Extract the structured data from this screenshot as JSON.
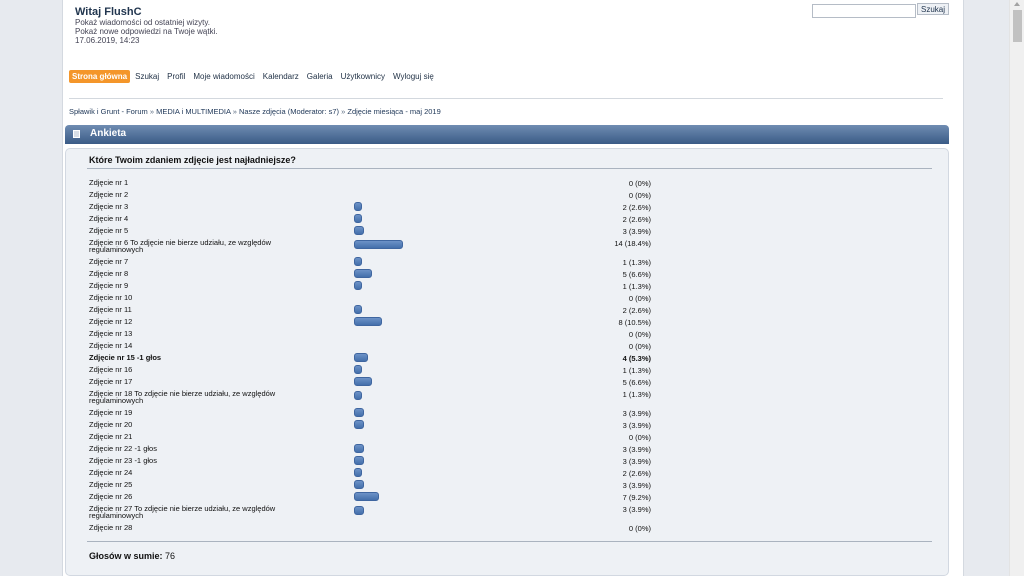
{
  "header": {
    "welcome": "Witaj FlushC",
    "line1": "Pokaż wiadomości od ostatniej wizyty.",
    "line2": "Pokaż nowe odpowiedzi na Twoje wątki.",
    "datetime": "17.06.2019, 14:23",
    "search_placeholder": "",
    "search_button": "Szukaj"
  },
  "nav": [
    {
      "label": "Strona główna",
      "active": true
    },
    {
      "label": "Szukaj"
    },
    {
      "label": "Profil"
    },
    {
      "label": "Moje wiadomości"
    },
    {
      "label": "Kalendarz"
    },
    {
      "label": "Galeria"
    },
    {
      "label": "Użytkownicy"
    },
    {
      "label": "Wyloguj się"
    }
  ],
  "breadcrumb": [
    "Spławik i Grunt - Forum",
    "MEDIA i MULTIMEDIA",
    "Nasze zdjęcia (Moderator: s7)",
    "Zdjęcie miesiąca - maj 2019"
  ],
  "breadcrumb_separator": "»",
  "poll": {
    "title": "Ankieta",
    "question": "Które Twoim zdaniem zdjęcie jest najładniejsze?",
    "total_label": "Głosów w sumie:",
    "total_value": "76",
    "max_percent": 18.4,
    "options": [
      {
        "label": "Zdjęcie nr 1",
        "result": "0 (0%)",
        "percent": 0
      },
      {
        "label": "Zdjęcie nr 2",
        "result": "0 (0%)",
        "percent": 0
      },
      {
        "label": "Zdjęcie nr 3",
        "result": "2 (2.6%)",
        "percent": 2.6
      },
      {
        "label": "Zdjęcie nr 4",
        "result": "2 (2.6%)",
        "percent": 2.6
      },
      {
        "label": "Zdjęcie nr 5",
        "result": "3 (3.9%)",
        "percent": 3.9
      },
      {
        "label": "Zdjęcie nr 6  To zdjęcie nie bierze udziału, ze względów regulaminowych",
        "result": "14 (18.4%)",
        "percent": 18.4
      },
      {
        "label": "Zdjęcie nr 7",
        "result": "1 (1.3%)",
        "percent": 1.3
      },
      {
        "label": "Zdjęcie nr 8",
        "result": "5 (6.6%)",
        "percent": 6.6
      },
      {
        "label": "Zdjęcie nr 9",
        "result": "1 (1.3%)",
        "percent": 1.3
      },
      {
        "label": "Zdjęcie nr 10",
        "result": "0 (0%)",
        "percent": 0
      },
      {
        "label": "Zdjęcie nr 11",
        "result": "2 (2.6%)",
        "percent": 2.6
      },
      {
        "label": "Zdjęcie nr 12",
        "result": "8 (10.5%)",
        "percent": 10.5
      },
      {
        "label": "Zdjęcie nr 13",
        "result": "0 (0%)",
        "percent": 0
      },
      {
        "label": "Zdjęcie nr 14",
        "result": "0 (0%)",
        "percent": 0
      },
      {
        "label": "Zdjęcie nr 15   -1 głos",
        "result": "4 (5.3%)",
        "percent": 5.3,
        "voted": true
      },
      {
        "label": "Zdjęcie nr 16",
        "result": "1 (1.3%)",
        "percent": 1.3
      },
      {
        "label": "Zdjęcie nr 17",
        "result": "5 (6.6%)",
        "percent": 6.6
      },
      {
        "label": "Zdjęcie nr 18  To zdjęcie nie bierze udziału, ze względów regulaminowych",
        "result": "1 (1.3%)",
        "percent": 1.3
      },
      {
        "label": "Zdjęcie nr 19",
        "result": "3 (3.9%)",
        "percent": 3.9
      },
      {
        "label": "Zdjęcie nr 20",
        "result": "3 (3.9%)",
        "percent": 3.9
      },
      {
        "label": "Zdjęcie nr 21",
        "result": "0 (0%)",
        "percent": 0
      },
      {
        "label": "Zdjęcie nr 22  -1 głos",
        "result": "3 (3.9%)",
        "percent": 3.9
      },
      {
        "label": "Zdjęcie nr 23  -1 głos",
        "result": "3 (3.9%)",
        "percent": 3.9
      },
      {
        "label": "Zdjęcie nr 24",
        "result": "2 (2.6%)",
        "percent": 2.6
      },
      {
        "label": "Zdjęcie nr 25",
        "result": "3 (3.9%)",
        "percent": 3.9
      },
      {
        "label": "Zdjęcie nr 26",
        "result": "7 (9.2%)",
        "percent": 9.2
      },
      {
        "label": "Zdjęcie nr 27  To zdjęcie nie bierze udziału, ze względów regulaminowych",
        "result": "3 (3.9%)",
        "percent": 3.9
      },
      {
        "label": "Zdjęcie nr 28",
        "result": "0 (0%)",
        "percent": 0
      }
    ]
  },
  "colors": {
    "accent": "#f4962a",
    "poll_header": "#3a5b86",
    "bar": "#4470ab"
  }
}
